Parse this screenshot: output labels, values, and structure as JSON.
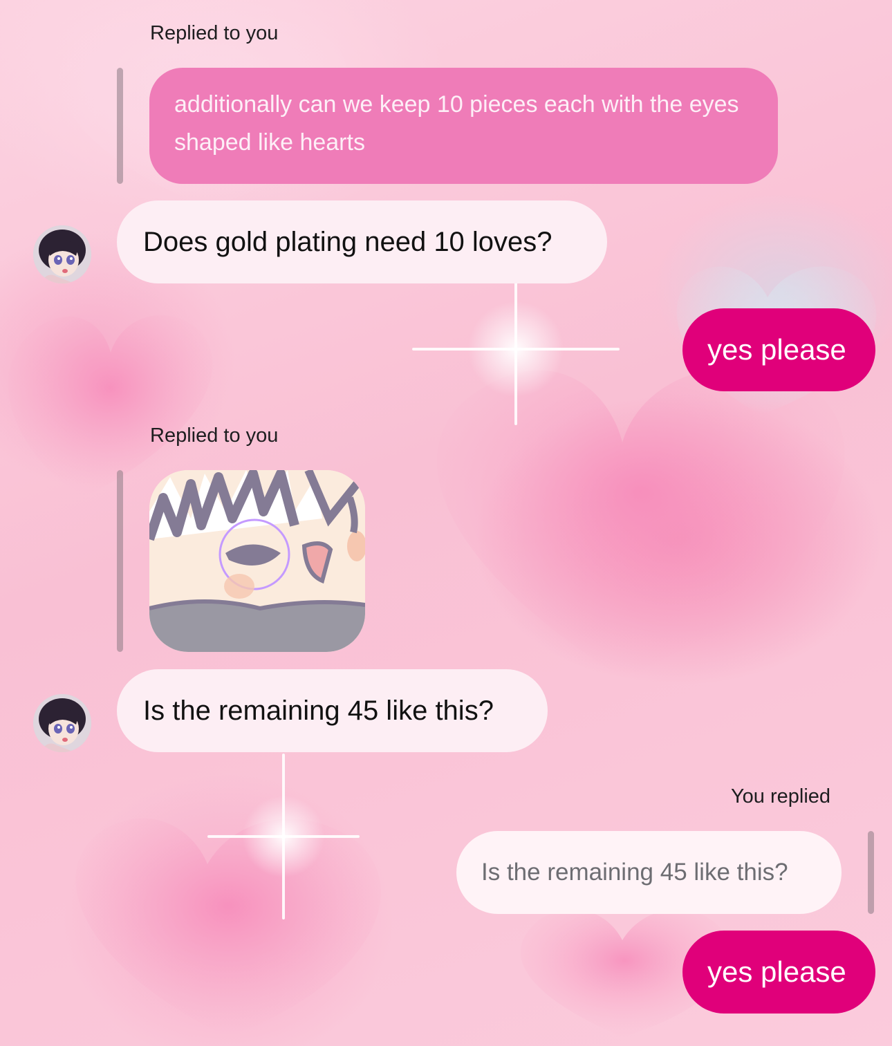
{
  "theme": {
    "accent": "#e0007a",
    "quoted_bubble": "#ef7cb8",
    "incoming_bubble": "#fdeef4"
  },
  "messages": [
    {
      "reply_label": "Replied to you",
      "quoted_text": "additionally can we keep 10 pieces each with the eyes shaped like hearts",
      "incoming_text": "Does gold plating need 10 loves?",
      "avatar_icon": "anime-girl-avatar-icon"
    },
    {
      "outgoing_text": "yes please"
    },
    {
      "reply_label": "Replied to you",
      "quoted_image_icon": "cartoon-face-thumbnail",
      "incoming_text": "Is the remaining 45 like this?",
      "avatar_icon": "anime-girl-avatar-icon"
    },
    {
      "reply_label": "You replied",
      "quoted_text": "Is the remaining 45 like this?",
      "outgoing_text": "yes please"
    }
  ]
}
